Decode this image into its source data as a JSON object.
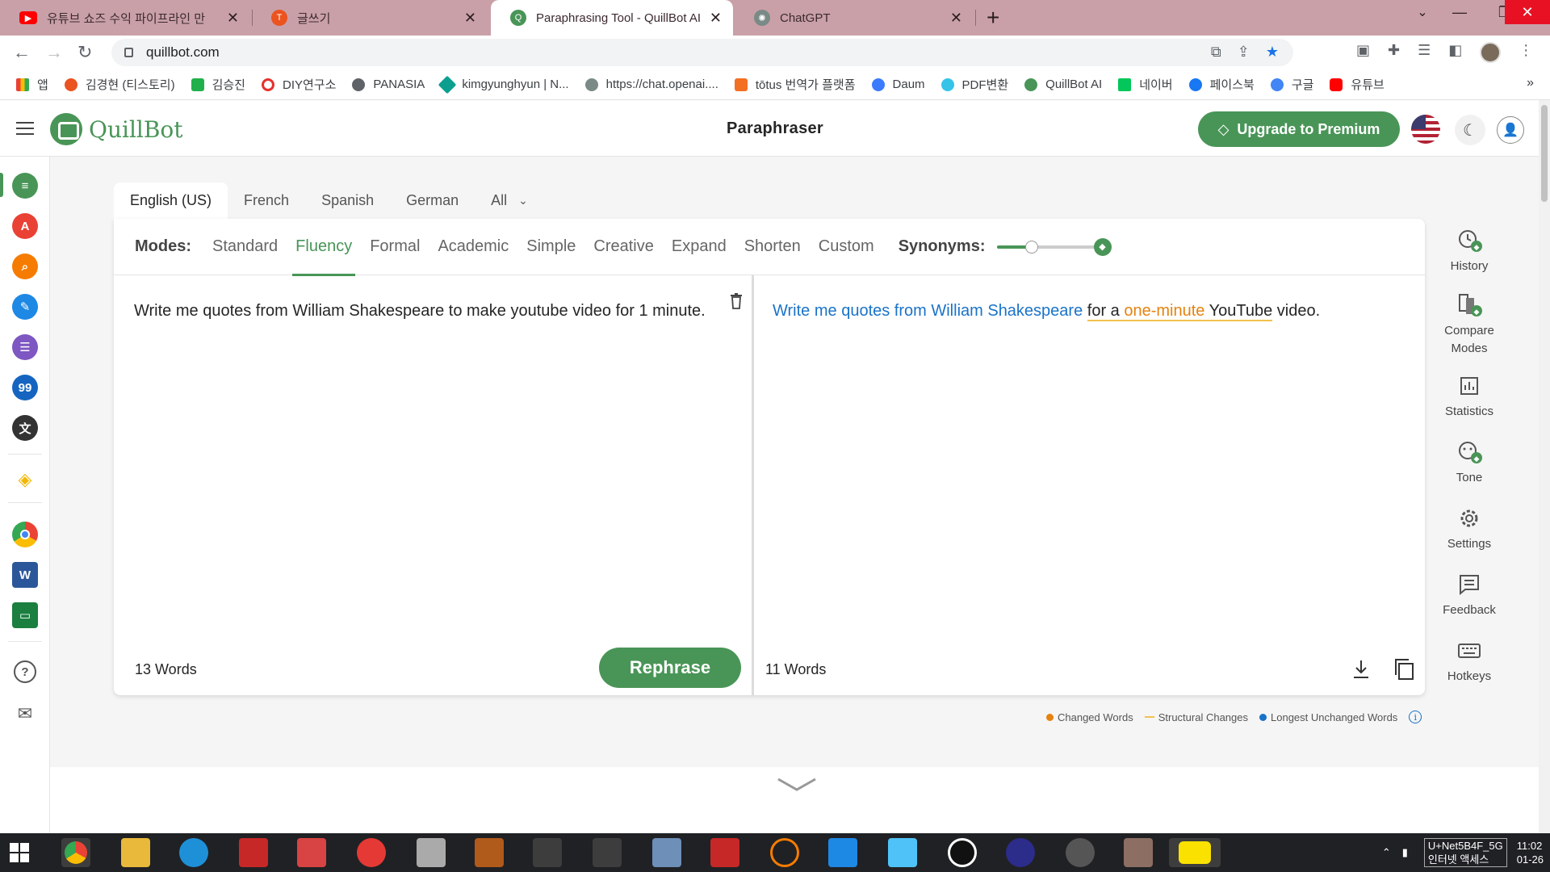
{
  "browser": {
    "tabs": [
      {
        "title": "유튜브 쇼즈 수익 파이프라인 만",
        "favicon_color": "#ff0000"
      },
      {
        "title": "글쓰기",
        "favicon_color": "#eb531f"
      },
      {
        "title": "Paraphrasing Tool - QuillBot AI",
        "favicon_color": "#499557",
        "active": true
      },
      {
        "title": "ChatGPT",
        "favicon_color": "#7a8a86"
      }
    ],
    "url": "quillbot.com",
    "bookmarks": [
      {
        "label": "앱",
        "color": "#e94235"
      },
      {
        "label": "김경현 (티스토리)",
        "color": "#eb531f"
      },
      {
        "label": "김승진",
        "color": "#21b04b"
      },
      {
        "label": "DIY연구소",
        "color": "#e5312d"
      },
      {
        "label": "PANASIA",
        "color": "#5f6368"
      },
      {
        "label": "kimgyunghyun | N...",
        "color": "#0c9f8f"
      },
      {
        "label": "https://chat.openai....",
        "color": "#7a8a86"
      },
      {
        "label": "tōtus 번역가 플랫폼",
        "color": "#f36f21"
      },
      {
        "label": "Daum",
        "color": "#3a7bfd"
      },
      {
        "label": "PDF변환",
        "color": "#35c3e8"
      },
      {
        "label": "QuillBot AI",
        "color": "#499557"
      },
      {
        "label": "네이버",
        "color": "#03c75a"
      },
      {
        "label": "페이스북",
        "color": "#1877f2"
      },
      {
        "label": "구글",
        "color": "#4285f4"
      },
      {
        "label": "유튜브",
        "color": "#ff0000"
      }
    ]
  },
  "header": {
    "logo_text": "QuillBot",
    "title": "Paraphraser",
    "premium_label": "Upgrade to Premium"
  },
  "languages": [
    "English (US)",
    "French",
    "Spanish",
    "German",
    "All"
  ],
  "modes": {
    "label": "Modes:",
    "items": [
      "Standard",
      "Fluency",
      "Formal",
      "Academic",
      "Simple",
      "Creative",
      "Expand",
      "Shorten",
      "Custom"
    ],
    "active": "Fluency",
    "synonyms_label": "Synonyms:",
    "synonyms_level": 0.33
  },
  "input": {
    "text": "Write me quotes from William Shakespeare to make youtube video for 1 minute.",
    "word_count": "13 Words",
    "rephrase_label": "Rephrase"
  },
  "output": {
    "segments": [
      {
        "text": "Write me quotes from William Shakespeare",
        "kind": "unchanged"
      },
      {
        "text": " ",
        "kind": "plain"
      },
      {
        "text": "for a ",
        "kind": "structural"
      },
      {
        "text": "one-minute",
        "kind": "changed-structural"
      },
      {
        "text": " YouTube",
        "kind": "structural"
      },
      {
        "text": " video.",
        "kind": "plain"
      }
    ],
    "word_count": "11 Words"
  },
  "legend": {
    "changed": "Changed Words",
    "structural": "Structural Changes",
    "unchanged": "Longest Unchanged Words",
    "colors": {
      "changed": "#e6820e",
      "structural": "#f2c14e",
      "unchanged": "#1a73c8"
    }
  },
  "tools": [
    "History",
    "Compare Modes",
    "Statistics",
    "Tone",
    "Settings",
    "Feedback",
    "Hotkeys"
  ],
  "taskbar": {
    "network": [
      "U+Net5B4F_5G",
      "인터넷 액세스"
    ],
    "clock": [
      "11:02",
      "01-26"
    ]
  }
}
